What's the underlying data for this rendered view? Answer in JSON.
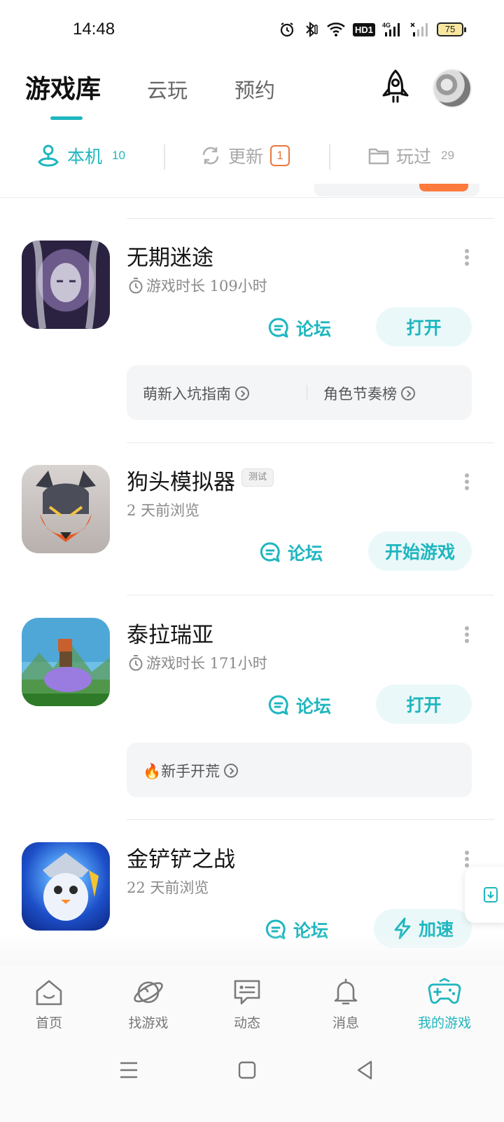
{
  "status_bar": {
    "time": "14:48",
    "network": "4G",
    "hd_label": "HD1",
    "battery": "75"
  },
  "header": {
    "tabs": [
      {
        "label": "游戏库",
        "active": true
      },
      {
        "label": "云玩",
        "active": false
      },
      {
        "label": "预约",
        "active": false
      }
    ],
    "rocket_icon": "rocket-icon",
    "avatar_icon": "user-avatar"
  },
  "subtabs": [
    {
      "label": "本机",
      "count": "10",
      "icon": "joystick-icon",
      "active": true
    },
    {
      "label": "更新",
      "badge": "1",
      "icon": "refresh-icon",
      "active": false
    },
    {
      "label": "玩过",
      "count": "29",
      "icon": "folder-icon",
      "active": false
    }
  ],
  "games": [
    {
      "title": "无期迷途",
      "meta": "游戏时长 109小时",
      "meta_icon": "timer-icon",
      "forum_label": "论坛",
      "action_label": "打开",
      "guides": [
        "萌新入坑指南",
        "角色节奏榜"
      ]
    },
    {
      "title": "狗头模拟器",
      "badge": "测试",
      "meta": "2 天前浏览",
      "forum_label": "论坛",
      "action_label": "开始游戏"
    },
    {
      "title": "泰拉瑞亚",
      "meta": "游戏时长 171小时",
      "meta_icon": "timer-icon",
      "forum_label": "论坛",
      "action_label": "打开",
      "guides": [
        "🔥新手开荒"
      ]
    },
    {
      "title": "金铲铲之战",
      "meta": "22 天前浏览",
      "forum_label": "论坛",
      "action_label": "加速",
      "action_icon": "lightning-icon"
    }
  ],
  "bottom_nav": [
    {
      "label": "首页",
      "icon": "home-icon",
      "active": false
    },
    {
      "label": "找游戏",
      "icon": "planet-icon",
      "active": false
    },
    {
      "label": "动态",
      "icon": "message-icon",
      "active": false
    },
    {
      "label": "消息",
      "icon": "bell-icon",
      "active": false
    },
    {
      "label": "我的游戏",
      "icon": "gamepad-icon",
      "active": true
    }
  ],
  "colors": {
    "accent": "#1fb6bf",
    "badge_orange": "#e8773b",
    "button_bg": "#eaf8f9"
  }
}
